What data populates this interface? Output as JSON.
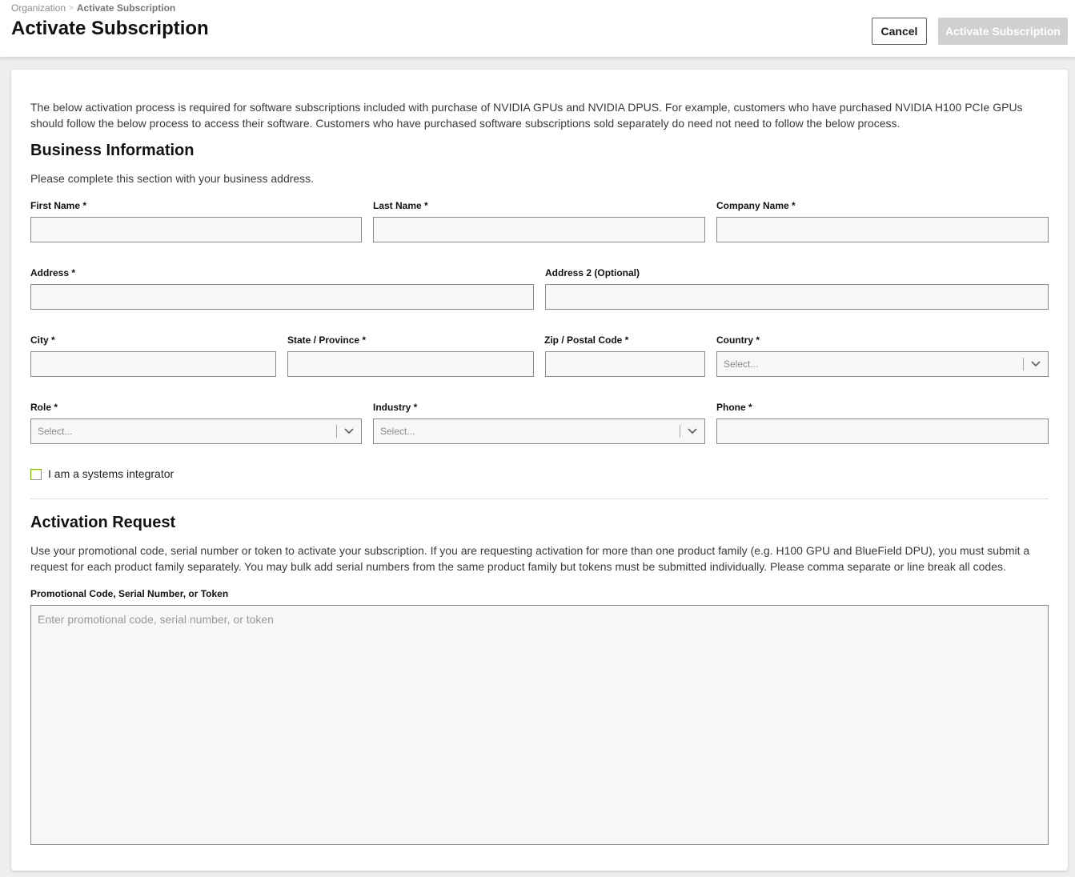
{
  "header": {
    "breadcrumb": [
      "Organization",
      "Activate Subscription"
    ],
    "title": "Activate Subscription",
    "cancel_label": "Cancel",
    "activate_label": "Activate Subscription"
  },
  "intro": "The below activation process is required for software subscriptions included with purchase of NVIDIA GPUs and NVIDIA DPUS. For example, customers who have purchased NVIDIA H100 PCIe GPUs should follow the below process to access their software. Customers who have purchased software subscriptions sold separately do need not need to follow the below process.",
  "business": {
    "title": "Business Information",
    "description": "Please complete this section with your business address.",
    "fields": {
      "first_name": "First Name *",
      "last_name": "Last Name *",
      "company_name": "Company Name *",
      "address": "Address *",
      "address2": "Address 2 (Optional)",
      "city": "City *",
      "state": "State / Province *",
      "zip": "Zip / Postal Code *",
      "country": "Country *",
      "role": "Role *",
      "industry": "Industry *",
      "phone": "Phone *"
    },
    "select_placeholder": "Select...",
    "systems_integrator_label": "I am a systems integrator"
  },
  "activation": {
    "title": "Activation Request",
    "description": "Use your promotional code, serial number or token to activate your subscription. If you are requesting activation for more than one product family (e.g. H100 GPU and BlueField DPU), you must submit a request for each product family separately. You may bulk add serial numbers from the same product family but tokens must be submitted individually. Please comma separate or line break all codes.",
    "code_label": "Promotional Code, Serial Number, or Token",
    "code_placeholder": "Enter promotional code, serial number, or token"
  },
  "colors": {
    "accent": "#76b900",
    "disabled_button": "#d0d0d0"
  }
}
